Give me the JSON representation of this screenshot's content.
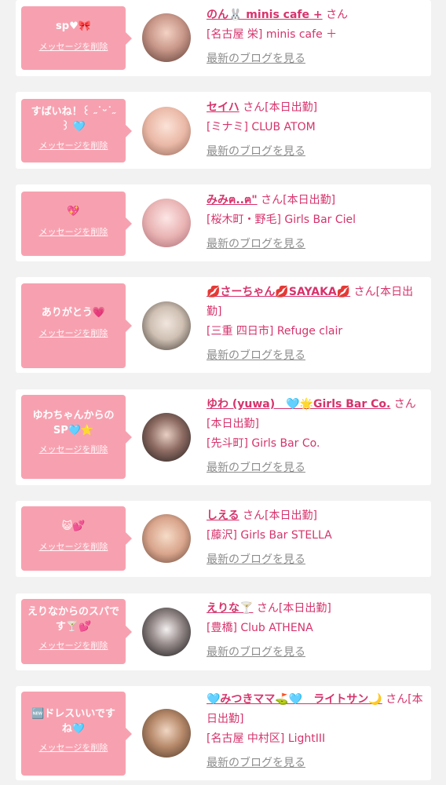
{
  "accent": "#d6336c",
  "bubble_color": "#f7a1b0",
  "items": [
    {
      "message": "sp♥🎀",
      "delete_label": "メッセージを削除",
      "name": "のん🐰 minis cafe +",
      "suffix": "さん",
      "store": "[名古屋 栄] minis cafe ＋",
      "blog_label": "最新のブログを見る",
      "avatar_icon": "girl-photo"
    },
    {
      "message": "すばいね！꒰ ˶˙ᵕ˙˶ ꒱ 🩵",
      "delete_label": "メッセージを削除",
      "name": "セイハ",
      "suffix": "さん[本日出勤]",
      "store": "[ミナミ] CLUB ATOM",
      "blog_label": "最新のブログを見る",
      "avatar_icon": "girl-photo"
    },
    {
      "message": "💖",
      "delete_label": "メッセージを削除",
      "name": "みみฅ..ฅ\"",
      "suffix": "さん[本日出勤]",
      "store": "[桜木町・野毛] Girls Bar Ciel",
      "blog_label": "最新のブログを見る",
      "avatar_icon": "girl-photo"
    },
    {
      "message": "ありがとう💗",
      "delete_label": "メッセージを削除",
      "name": "💋さーちゃん💋SAYAKA💋",
      "suffix": "さん[本日出勤]",
      "store": "[三重 四日市] Refuge clair",
      "blog_label": "最新のブログを見る",
      "avatar_icon": "girl-photo"
    },
    {
      "message": "ゆわちゃんからのSP🩵⭐",
      "delete_label": "メッセージを削除",
      "name": "ゆわ (yuwa)　🩵🌟Girls Bar Co.",
      "suffix": "さん[本日出勤]",
      "store": "[先斗町] Girls Bar Co.",
      "blog_label": "最新のブログを見る",
      "avatar_icon": "girl-photo"
    },
    {
      "message": "😺💕",
      "delete_label": "メッセージを削除",
      "name": "しえる",
      "suffix": "さん[本日出勤]",
      "store": "[藤沢] Girls Bar STELLA",
      "blog_label": "最新のブログを見る",
      "avatar_icon": "girl-photo"
    },
    {
      "message": "えりなからのスパです🍸💕",
      "delete_label": "メッセージを削除",
      "name": "えりな🍸",
      "suffix": "さん[本日出勤]",
      "store": "[豊橋] Club ATHENA",
      "blog_label": "最新のブログを見る",
      "avatar_icon": "girl-photo"
    },
    {
      "message": "🆕ドレスいいですね🩵",
      "delete_label": "メッセージを削除",
      "name": "🩵みつきママ⛳🩵　ライトサン🌙",
      "suffix": "さん[本日出勤]",
      "store": "[名古屋 中村区] LightIII",
      "blog_label": "最新のブログを見る",
      "avatar_icon": "girl-photo"
    }
  ]
}
